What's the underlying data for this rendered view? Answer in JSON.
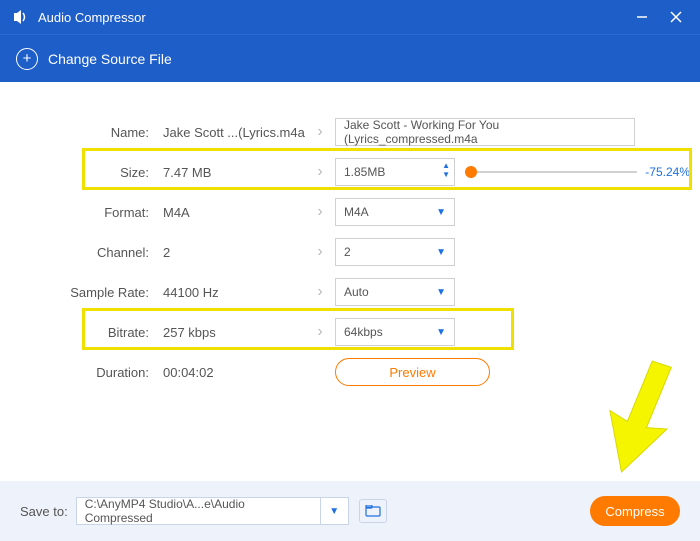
{
  "window": {
    "title": "Audio Compressor"
  },
  "toolbar": {
    "change_source": "Change Source File"
  },
  "labels": {
    "name": "Name:",
    "size": "Size:",
    "format": "Format:",
    "channel": "Channel:",
    "sample_rate": "Sample Rate:",
    "bitrate": "Bitrate:",
    "duration": "Duration:"
  },
  "original": {
    "name": "Jake Scott ...(Lyrics.m4a",
    "size": "7.47 MB",
    "format": "M4A",
    "channel": "2",
    "sample_rate": "44100 Hz",
    "bitrate": "257 kbps",
    "duration": "00:04:02"
  },
  "target": {
    "name": "Jake Scott - Working For You (Lyrics_compressed.m4a",
    "size": "1.85MB",
    "format": "M4A",
    "channel": "2",
    "sample_rate": "Auto",
    "bitrate": "64kbps",
    "size_delta": "-75.24%"
  },
  "buttons": {
    "preview": "Preview",
    "compress": "Compress"
  },
  "footer": {
    "save_to_label": "Save to:",
    "path": "C:\\AnyMP4 Studio\\A...e\\Audio Compressed"
  }
}
